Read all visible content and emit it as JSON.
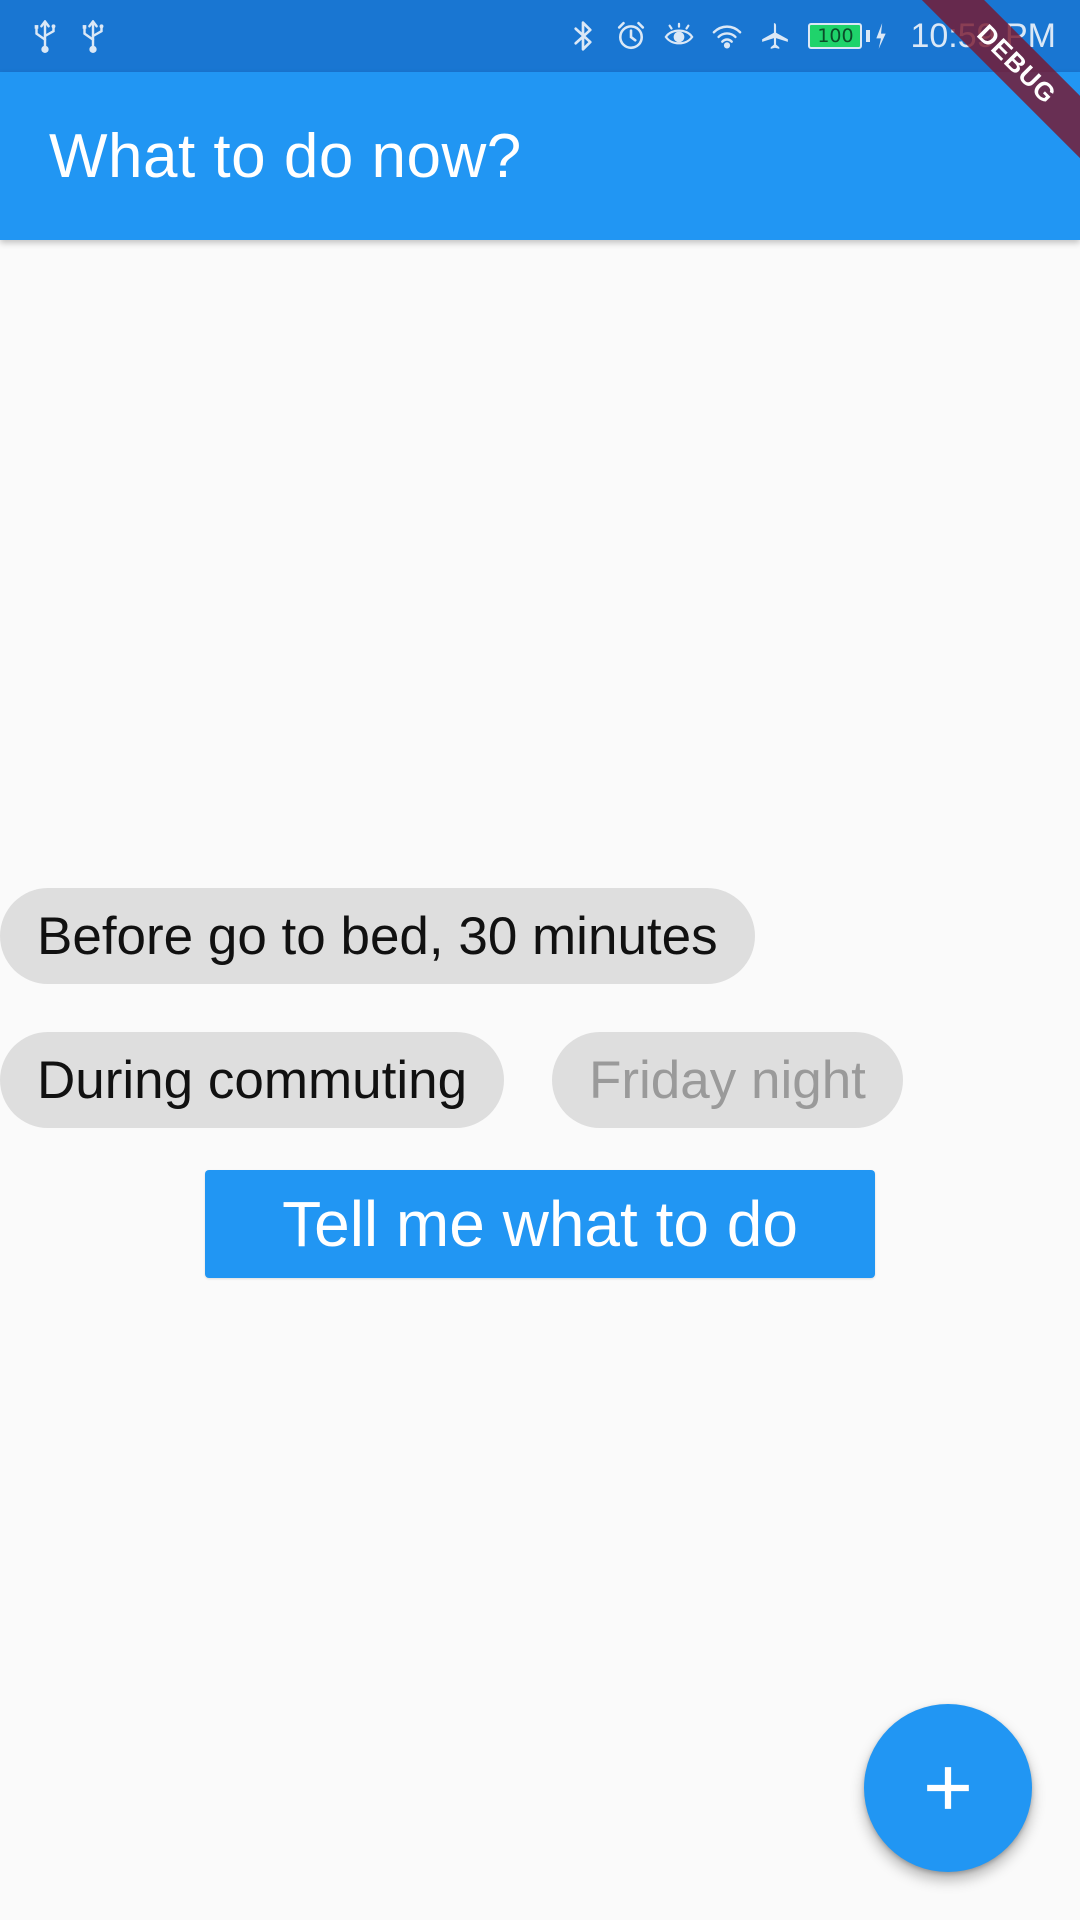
{
  "status_bar": {
    "left_icons": [
      "usb-icon",
      "usb-icon"
    ],
    "right_icons": [
      "bluetooth-icon",
      "alarm-icon",
      "eye-icon",
      "wifi-icon",
      "airplane-icon"
    ],
    "battery_level": "100",
    "time": "10:59 PM"
  },
  "debug_banner": {
    "label": "DEBUG"
  },
  "app_bar": {
    "title": "What to do now?"
  },
  "chips": [
    {
      "label": "Before go to bed, 30 minutes",
      "enabled": true
    },
    {
      "label": "During commuting",
      "enabled": true
    },
    {
      "label": "Friday night",
      "enabled": false
    }
  ],
  "main_button": {
    "label": "Tell me what to do"
  },
  "fab": {
    "icon": "plus-icon"
  },
  "colors": {
    "primary": "#2196f3",
    "status_bar": "#1976d2",
    "chip_background": "#dedede",
    "background": "#fafafa"
  }
}
